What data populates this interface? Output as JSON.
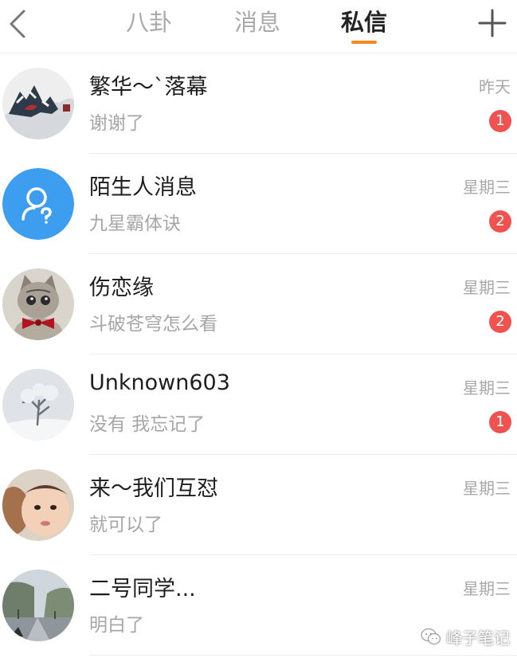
{
  "header": {
    "tabs": [
      {
        "label": "八卦",
        "active": false
      },
      {
        "label": "消息",
        "active": false
      },
      {
        "label": "私信",
        "active": true
      }
    ],
    "back_icon": "chevron-left-icon",
    "add_icon": "plus-icon",
    "accent_color": "#f08a24"
  },
  "conversations": [
    {
      "name": "繁华～`落幕",
      "preview": "谢谢了",
      "time": "昨天",
      "unread": "1",
      "avatar": "ink-painting-avatar"
    },
    {
      "name": "陌生人消息",
      "preview": "九星霸体诀",
      "time": "星期三",
      "unread": "2",
      "avatar": "stranger-user-icon"
    },
    {
      "name": "伤恋缘",
      "preview": "斗破苍穹怎么看",
      "time": "星期三",
      "unread": "2",
      "avatar": "kitten-avatar"
    },
    {
      "name": "Unknown603",
      "preview": "没有  我忘记了",
      "time": "星期三",
      "unread": "1",
      "avatar": "winter-tree-avatar"
    },
    {
      "name": "来～我们互怼",
      "preview": "就可以了",
      "time": "星期三",
      "unread": "",
      "avatar": "baby-photo-avatar"
    },
    {
      "name": "二号同学...",
      "preview": "明白了",
      "time": "星期三",
      "unread": "",
      "avatar": "road-trees-avatar"
    }
  ],
  "badge_color": "#ef5350",
  "watermark": {
    "text": "峰子笔记",
    "icon": "wechat-logo-icon"
  }
}
